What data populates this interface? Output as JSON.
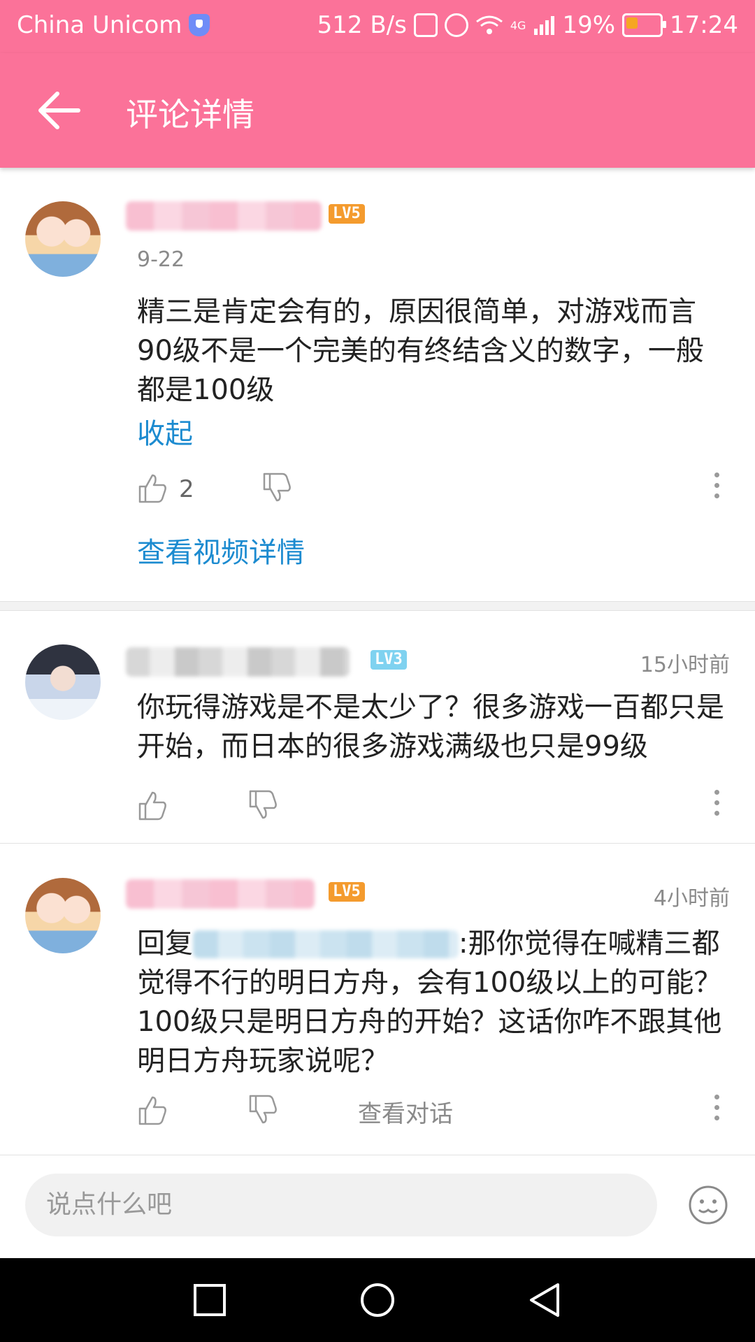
{
  "status_bar": {
    "carrier": "China Unicom",
    "net_speed": "512 B/s",
    "signal_label": "4G",
    "battery": "19%",
    "battery_level": 0.19,
    "time": "17:24"
  },
  "app_bar": {
    "title": "评论详情"
  },
  "comments": [
    {
      "level": "LV5",
      "date": "9-22",
      "text": "精三是肯定会有的，原因很简单，对游戏而言90级不是一个完美的有终结含义的数字，一般都是100级",
      "collapse_label": "收起",
      "likes": "2",
      "view_video_label": "查看视频详情"
    },
    {
      "level": "LV3",
      "time": "15小时前",
      "text": "你玩得游戏是不是太少了？很多游戏一百都只是开始，而日本的很多游戏满级也只是99级"
    },
    {
      "level": "LV5",
      "time": "4小时前",
      "reply_prefix": "回复",
      "text": ":那你觉得在喊精三都觉得不行的明日方舟，会有100级以上的可能？100级只是明日方舟的开始？这话你咋不跟其他明日方舟玩家说呢？",
      "view_conversation_label": "查看对话"
    }
  ],
  "input": {
    "placeholder": "说点什么吧"
  },
  "colors": {
    "brand": "#fb7299",
    "link": "#1c8bd0",
    "lv5": "#f49b2e",
    "lv3": "#7fd2f0"
  }
}
